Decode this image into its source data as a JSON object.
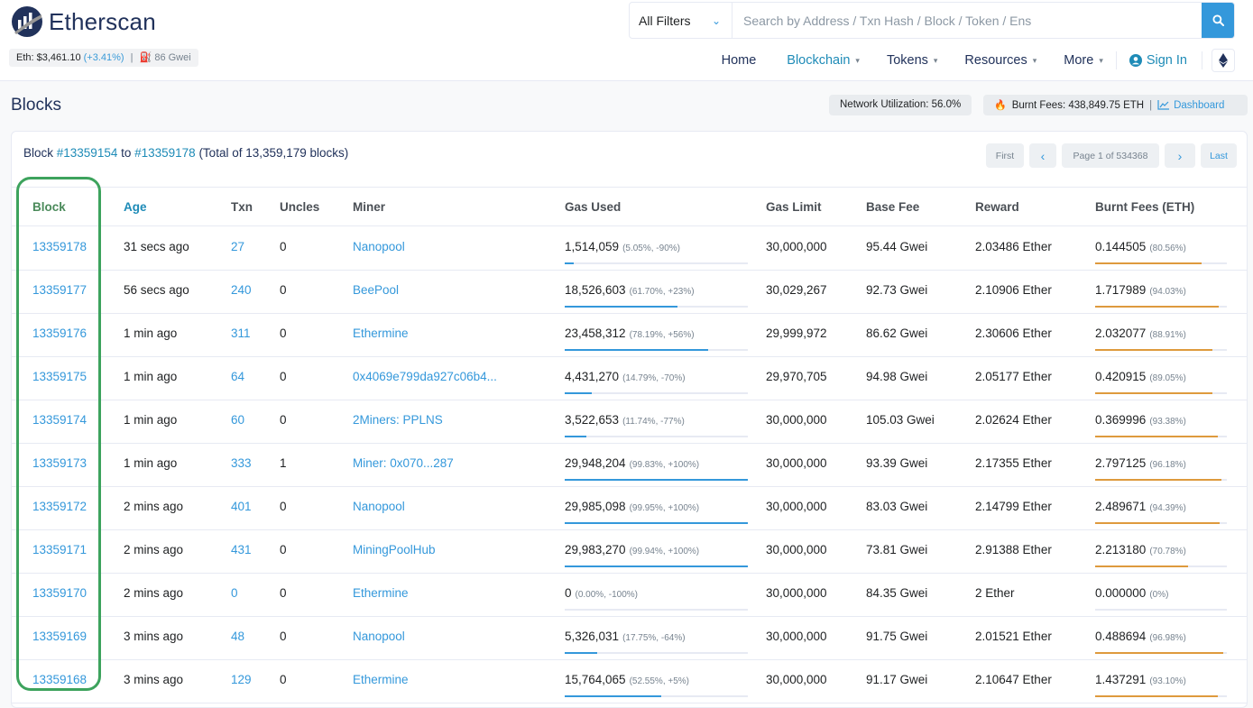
{
  "brand": {
    "name": "Etherscan"
  },
  "ticker": {
    "eth_label": "Eth: ",
    "eth_price": "$3,461.10",
    "eth_change": "(+3.41%)",
    "sep": "|",
    "gas": "86 Gwei"
  },
  "search": {
    "filter_label": "All Filters",
    "placeholder": "Search by Address / Txn Hash / Block / Token / Ens"
  },
  "nav": {
    "home": "Home",
    "blockchain": "Blockchain",
    "tokens": "Tokens",
    "resources": "Resources",
    "more": "More",
    "sign_in": "Sign In"
  },
  "page": {
    "title": "Blocks",
    "network_util": "Network Utilization: 56.0%",
    "burnt_fees": "Burnt Fees: 438,849.75 ETH",
    "burnt_sep": "|",
    "dashboard": "Dashboard"
  },
  "range": {
    "prefix": "Block ",
    "from": "#13359154",
    "to_word": " to ",
    "to": "#13359178",
    "total": " (Total of 13,359,179 blocks)"
  },
  "pager": {
    "first": "First",
    "prev": "‹",
    "page": "Page 1 of 534368",
    "next": "›",
    "last": "Last"
  },
  "columns": {
    "block": "Block",
    "age": "Age",
    "txn": "Txn",
    "uncles": "Uncles",
    "miner": "Miner",
    "gas_used": "Gas Used",
    "gas_limit": "Gas Limit",
    "base_fee": "Base Fee",
    "reward": "Reward",
    "burnt_fees": "Burnt Fees (ETH)"
  },
  "colors": {
    "gas_bar": "#3498db",
    "burnt_bar": "#de9a3d",
    "accent": "#3498db",
    "highlight": "#3da35d"
  },
  "rows": [
    {
      "block": "13359178",
      "age": "31 secs ago",
      "txn": "27",
      "uncles": "0",
      "miner": "Nanopool",
      "gas_used": "1,514,059",
      "gas_pct": "(5.05%, -90%)",
      "gas_fill": 0.0505,
      "gas_limit": "30,000,000",
      "base_fee": "95.44 Gwei",
      "reward": "2.03486 Ether",
      "burnt": "0.144505",
      "burnt_pct": "(80.56%)",
      "burnt_fill": 0.8056
    },
    {
      "block": "13359177",
      "age": "56 secs ago",
      "txn": "240",
      "uncles": "0",
      "miner": "BeePool",
      "gas_used": "18,526,603",
      "gas_pct": "(61.70%, +23%)",
      "gas_fill": 0.617,
      "gas_limit": "30,029,267",
      "base_fee": "92.73 Gwei",
      "reward": "2.10906 Ether",
      "burnt": "1.717989",
      "burnt_pct": "(94.03%)",
      "burnt_fill": 0.9403
    },
    {
      "block": "13359176",
      "age": "1 min ago",
      "txn": "311",
      "uncles": "0",
      "miner": "Ethermine",
      "gas_used": "23,458,312",
      "gas_pct": "(78.19%, +56%)",
      "gas_fill": 0.7819,
      "gas_limit": "29,999,972",
      "base_fee": "86.62 Gwei",
      "reward": "2.30606 Ether",
      "burnt": "2.032077",
      "burnt_pct": "(88.91%)",
      "burnt_fill": 0.8891
    },
    {
      "block": "13359175",
      "age": "1 min ago",
      "txn": "64",
      "uncles": "0",
      "miner": "0x4069e799da927c06b4...",
      "gas_used": "4,431,270",
      "gas_pct": "(14.79%, -70%)",
      "gas_fill": 0.1479,
      "gas_limit": "29,970,705",
      "base_fee": "94.98 Gwei",
      "reward": "2.05177 Ether",
      "burnt": "0.420915",
      "burnt_pct": "(89.05%)",
      "burnt_fill": 0.8905
    },
    {
      "block": "13359174",
      "age": "1 min ago",
      "txn": "60",
      "uncles": "0",
      "miner": "2Miners: PPLNS",
      "gas_used": "3,522,653",
      "gas_pct": "(11.74%, -77%)",
      "gas_fill": 0.1174,
      "gas_limit": "30,000,000",
      "base_fee": "105.03 Gwei",
      "reward": "2.02624 Ether",
      "burnt": "0.369996",
      "burnt_pct": "(93.38%)",
      "burnt_fill": 0.9338
    },
    {
      "block": "13359173",
      "age": "1 min ago",
      "txn": "333",
      "uncles": "1",
      "miner": "Miner: 0x070...287",
      "gas_used": "29,948,204",
      "gas_pct": "(99.83%, +100%)",
      "gas_fill": 0.9983,
      "gas_limit": "30,000,000",
      "base_fee": "93.39 Gwei",
      "reward": "2.17355 Ether",
      "burnt": "2.797125",
      "burnt_pct": "(96.18%)",
      "burnt_fill": 0.9618
    },
    {
      "block": "13359172",
      "age": "2 mins ago",
      "txn": "401",
      "uncles": "0",
      "miner": "Nanopool",
      "gas_used": "29,985,098",
      "gas_pct": "(99.95%, +100%)",
      "gas_fill": 0.9995,
      "gas_limit": "30,000,000",
      "base_fee": "83.03 Gwei",
      "reward": "2.14799 Ether",
      "burnt": "2.489671",
      "burnt_pct": "(94.39%)",
      "burnt_fill": 0.9439
    },
    {
      "block": "13359171",
      "age": "2 mins ago",
      "txn": "431",
      "uncles": "0",
      "miner": "MiningPoolHub",
      "gas_used": "29,983,270",
      "gas_pct": "(99.94%, +100%)",
      "gas_fill": 0.9994,
      "gas_limit": "30,000,000",
      "base_fee": "73.81 Gwei",
      "reward": "2.91388 Ether",
      "burnt": "2.213180",
      "burnt_pct": "(70.78%)",
      "burnt_fill": 0.7078
    },
    {
      "block": "13359170",
      "age": "2 mins ago",
      "txn": "0",
      "uncles": "0",
      "miner": "Ethermine",
      "gas_used": "0",
      "gas_pct": "(0.00%, -100%)",
      "gas_fill": 0,
      "gas_limit": "30,000,000",
      "base_fee": "84.35 Gwei",
      "reward": "2 Ether",
      "burnt": "0.000000",
      "burnt_pct": "(0%)",
      "burnt_fill": 0
    },
    {
      "block": "13359169",
      "age": "3 mins ago",
      "txn": "48",
      "uncles": "0",
      "miner": "Nanopool",
      "gas_used": "5,326,031",
      "gas_pct": "(17.75%, -64%)",
      "gas_fill": 0.1775,
      "gas_limit": "30,000,000",
      "base_fee": "91.75 Gwei",
      "reward": "2.01521 Ether",
      "burnt": "0.488694",
      "burnt_pct": "(96.98%)",
      "burnt_fill": 0.9698
    },
    {
      "block": "13359168",
      "age": "3 mins ago",
      "txn": "129",
      "uncles": "0",
      "miner": "Ethermine",
      "gas_used": "15,764,065",
      "gas_pct": "(52.55%, +5%)",
      "gas_fill": 0.5255,
      "gas_limit": "30,000,000",
      "base_fee": "91.17 Gwei",
      "reward": "2.10647 Ether",
      "burnt": "1.437291",
      "burnt_pct": "(93.10%)",
      "burnt_fill": 0.931
    }
  ]
}
